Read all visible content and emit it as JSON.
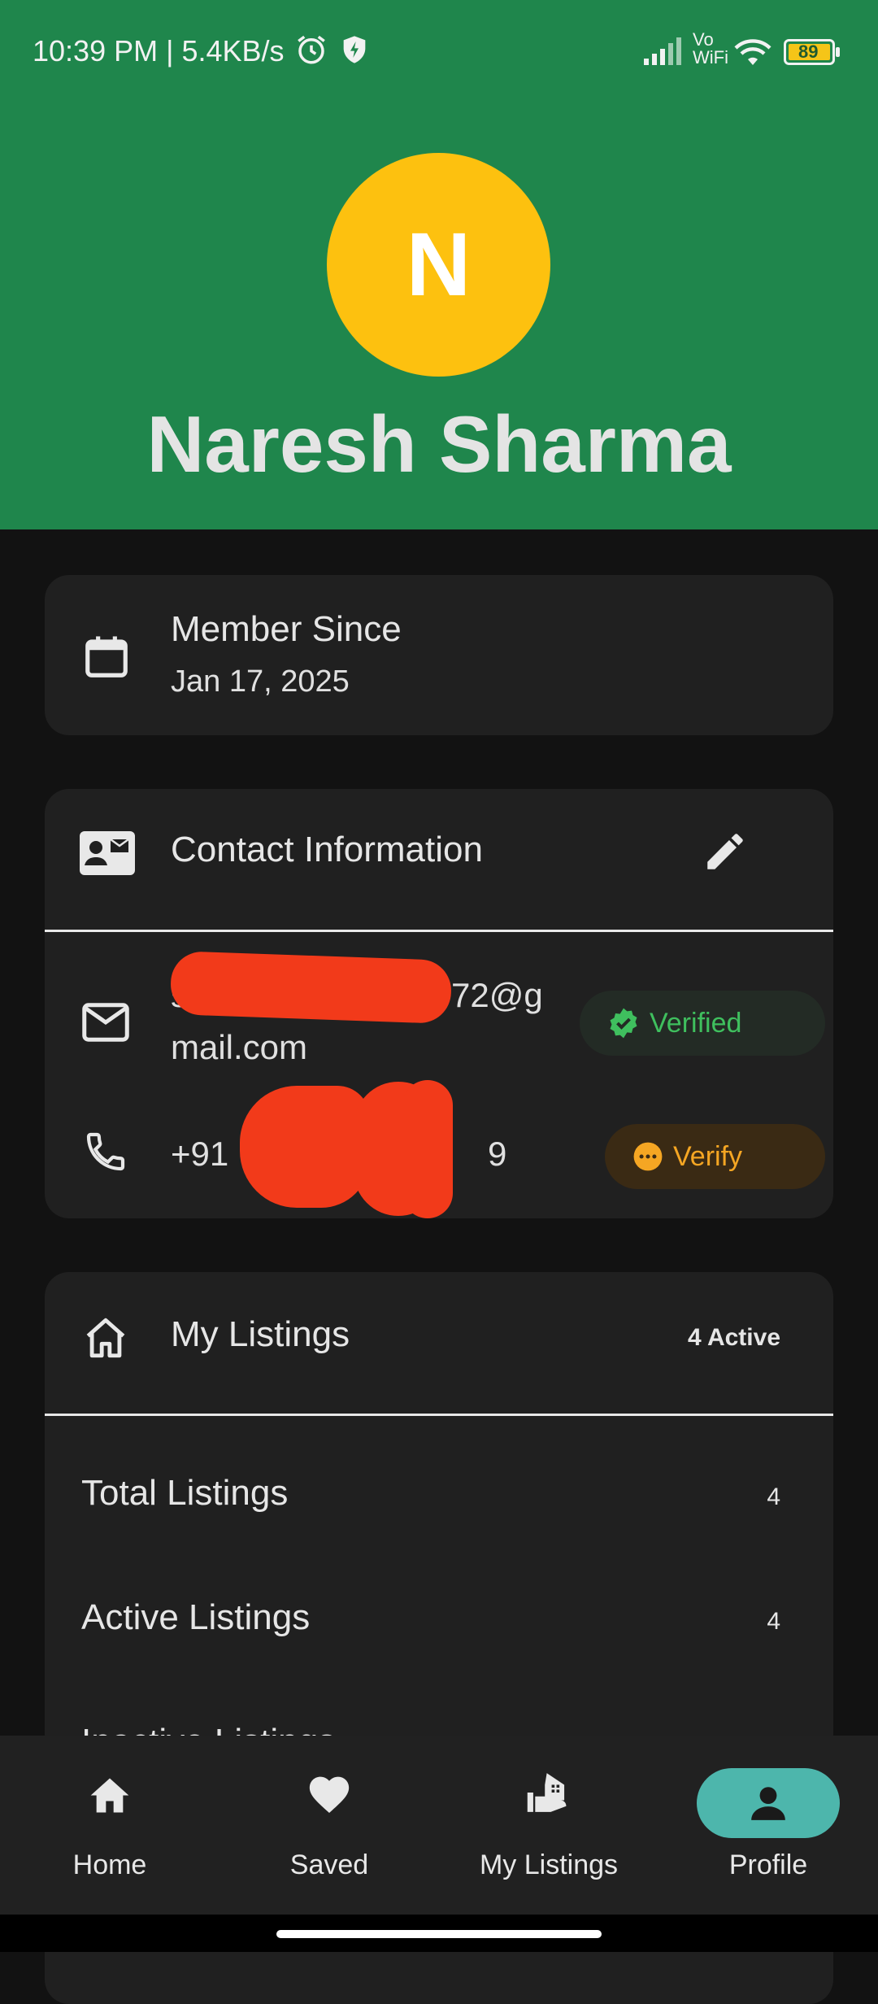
{
  "status_bar": {
    "time": "10:39 PM | 5.4KB/s",
    "vowifi": "Vo\nWiFi",
    "battery": "89"
  },
  "profile": {
    "initial": "N",
    "name": "Naresh Sharma"
  },
  "member": {
    "label": "Member Since",
    "date": "Jan 17, 2025"
  },
  "contact": {
    "title": "Contact Information",
    "email_line1": "sh",
    "email_line1_end": "72@g",
    "email_line2": "mail.com",
    "email_status": "Verified",
    "phone_prefix": "+91",
    "phone_end": "9",
    "phone_status": "Verify"
  },
  "listings": {
    "title": "My Listings",
    "active_badge": "4 Active",
    "stats": [
      {
        "label": "Total Listings",
        "value": "4"
      },
      {
        "label": "Active Listings",
        "value": "4"
      },
      {
        "label": "Inactive Listings",
        "value": ""
      }
    ]
  },
  "bottom_nav": {
    "items": [
      {
        "label": "Home",
        "icon": "home-icon"
      },
      {
        "label": "Saved",
        "icon": "heart-icon"
      },
      {
        "label": "My Listings",
        "icon": "listings-icon"
      },
      {
        "label": "Profile",
        "icon": "person-icon"
      }
    ],
    "active": "Profile"
  },
  "colors": {
    "header": "#1f864c",
    "avatar": "#fdc10f",
    "verified": "#3fbf5e",
    "verify": "#f5a623",
    "active_nav": "#4db6ac"
  }
}
